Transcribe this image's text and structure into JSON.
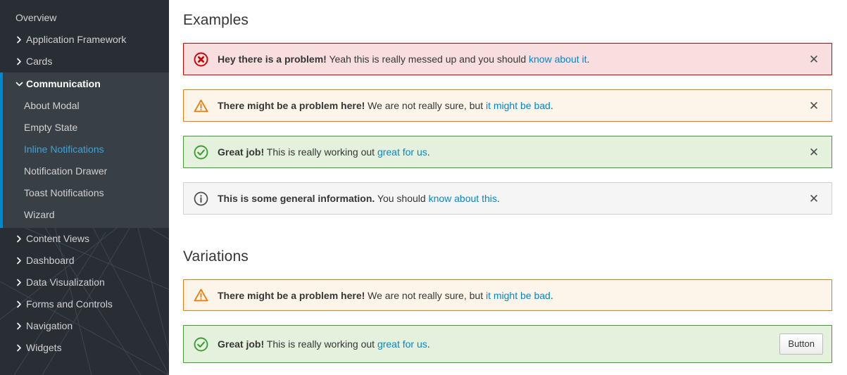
{
  "sidebar": {
    "items": [
      {
        "label": "Overview",
        "caret": "none",
        "type": "item"
      },
      {
        "label": "Application Framework",
        "caret": "right",
        "type": "item"
      },
      {
        "label": "Cards",
        "caret": "right",
        "type": "item"
      }
    ],
    "group": {
      "label": "Communication",
      "caret": "down",
      "expanded": true,
      "accent_color": "#0088ce",
      "children": [
        {
          "label": "About Modal",
          "active": false
        },
        {
          "label": "Empty State",
          "active": false
        },
        {
          "label": "Inline Notifications",
          "active": true
        },
        {
          "label": "Notification Drawer",
          "active": false
        },
        {
          "label": "Toast Notifications",
          "active": false
        },
        {
          "label": "Wizard",
          "active": false
        }
      ]
    },
    "items_after": [
      {
        "label": "Content Views",
        "caret": "right",
        "type": "item"
      },
      {
        "label": "Dashboard",
        "caret": "right",
        "type": "item"
      },
      {
        "label": "Data Visualization",
        "caret": "right",
        "type": "item"
      },
      {
        "label": "Forms and Controls",
        "caret": "right",
        "type": "item"
      },
      {
        "label": "Navigation",
        "caret": "right",
        "type": "item"
      },
      {
        "label": "Widgets",
        "caret": "right",
        "type": "item"
      }
    ]
  },
  "main": {
    "examples_title": "Examples",
    "variations_title": "Variations",
    "close_label": "✕",
    "examples": [
      {
        "variant": "danger",
        "icon": "error-circle-x-icon",
        "strong": "Hey there is a problem!",
        "body": " Yeah this is really messed up and you should ",
        "link": "know about it",
        "tail": ".",
        "accent": "#cc0000",
        "background": "#f8dedf",
        "dismissible": true
      },
      {
        "variant": "warning",
        "icon": "warning-triangle-icon",
        "strong": "There might be a problem here!",
        "body": " We are not really sure, but ",
        "link": "it might be bad",
        "tail": ".",
        "accent": "#ec7a08",
        "background": "#fdf5e9",
        "dismissible": true
      },
      {
        "variant": "success",
        "icon": "success-circle-check-icon",
        "strong": "Great job!",
        "body": " This is really working out ",
        "link": "great for us",
        "tail": ".",
        "accent": "#3f9c35",
        "background": "#e4f1dd",
        "dismissible": true
      },
      {
        "variant": "info",
        "icon": "info-circle-icon",
        "strong": "This is some general information.",
        "body": " You should ",
        "link": "know about this",
        "tail": ".",
        "accent": "#4d4d4d",
        "background": "#f5f5f5",
        "dismissible": true
      }
    ],
    "variations": [
      {
        "variant": "warning",
        "icon": "warning-triangle-icon",
        "strong": "There might be a problem here!",
        "body": " We are not really sure, but ",
        "link": "it might be bad",
        "tail": ".",
        "accent": "#ec7a08",
        "background": "#fdf5e9",
        "dismissible": false
      },
      {
        "variant": "success",
        "icon": "success-circle-check-icon",
        "strong": "Great job!",
        "body": " This is really working out ",
        "link": "great for us",
        "tail": ".",
        "accent": "#3f9c35",
        "background": "#e4f1dd",
        "dismissible": false,
        "button_label": "Button"
      }
    ]
  }
}
